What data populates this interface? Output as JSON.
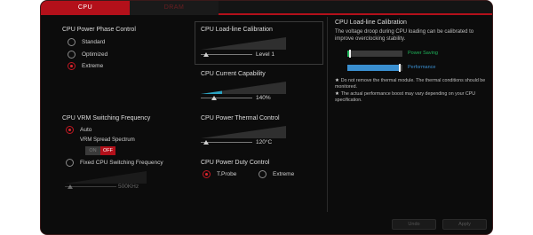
{
  "tabs": [
    {
      "label": "CPU"
    },
    {
      "label": "DRAM"
    }
  ],
  "phase_control": {
    "title": "CPU Power Phase Control",
    "options": [
      "Standard",
      "Optimized",
      "Extreme"
    ],
    "selected": "Extreme"
  },
  "vrm": {
    "title": "CPU VRM Switching Frequency",
    "auto_label": "Auto",
    "selected": "Auto",
    "spread_title": "VRM Spread Spectrum",
    "spread_on": "ON",
    "spread_off": "OFF",
    "fixed_label": "Fixed CPU Switching Frequency",
    "fixed_value": "500KHz",
    "fixed_level": 0.1
  },
  "loadline": {
    "title": "CPU Load-line Calibration",
    "value": "Level 1",
    "level": 0.1
  },
  "current": {
    "title": "CPU Current Capability",
    "value": "140%",
    "level": 0.25
  },
  "thermal": {
    "title": "CPU Power Thermal Control",
    "value": "120°C",
    "level": 0.1
  },
  "duty": {
    "title": "CPU Power Duty Control",
    "options": [
      "T.Probe",
      "Extreme"
    ],
    "selected": "T.Probe"
  },
  "info": {
    "title": "CPU Load-line Calibration",
    "description": "The voltage droop during CPU loading can be calibrated to improve overclocking stability.",
    "power_saving_label": "Power Saving",
    "performance_label": "Performance",
    "power_saving_level": 0.05,
    "performance_level": 0.95,
    "notes": [
      "Do not remove the thermal module. The thermal conditions should be monitored.",
      "The actual performance boost may vary depending on your CPU specification."
    ]
  },
  "footer": {
    "undo_label": "Undo",
    "apply_label": "Apply"
  },
  "colors": {
    "accent": "#b3101a",
    "power_saving": "#1fb35a",
    "performance": "#3a8fd0",
    "ramp": "#2f2f2f",
    "ramp_active": "#2aa3c2"
  }
}
